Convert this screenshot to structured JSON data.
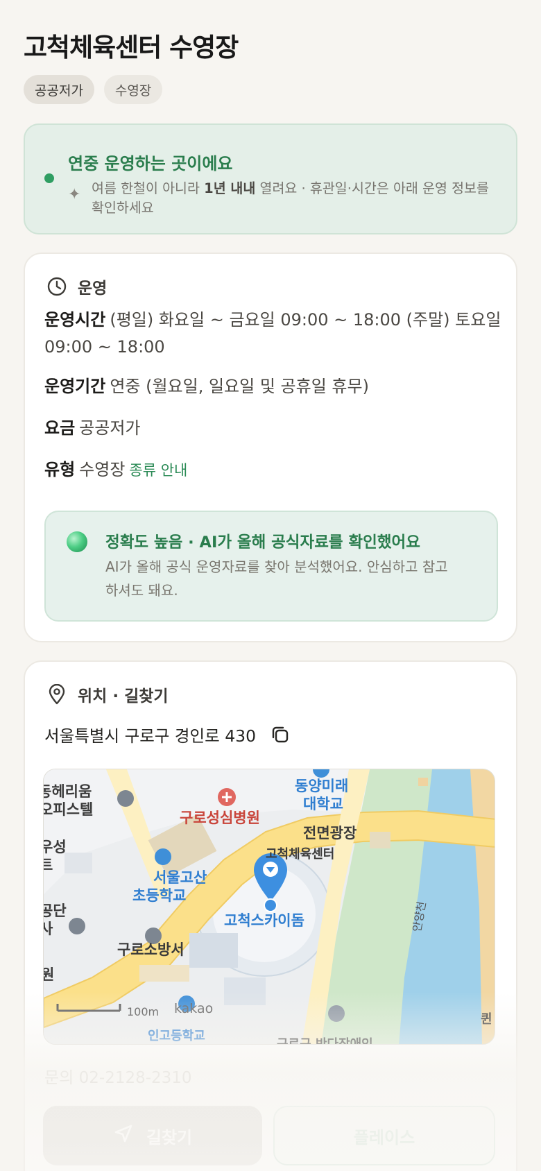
{
  "page": {
    "title": "고척체육센터 수영장",
    "chips": [
      "공공저가",
      "수영장"
    ]
  },
  "banner": {
    "title": "연중 운영하는 곳이에요",
    "text_before": "여름 한철이 아니라 ",
    "text_bold": "1년 내내",
    "text_after": " 열려요 · 휴관일·시간은 아래 운영 정보를 확인하세요",
    "icon": "sparkle-icon"
  },
  "operations": {
    "heading": "운영",
    "icon": "clock-icon",
    "hours_key": "운영시간",
    "hours_value": "(평일) 화요일 ~ 금요일 09:00 ~ 18:00 (주말) 토요일 09:00 ~ 18:00",
    "period_key": "운영기간",
    "period_value": "연중 (월요일, 일요일 및 공휴일 휴무)",
    "fee_key": "요금",
    "fee_value": "공공저가",
    "type_key": "유형",
    "type_value": "수영장",
    "type_link": "종류 안내",
    "accuracy": {
      "title": "정확도 높음 · AI가 올해 공식자료를 확인했어요",
      "text": "AI가 올해 공식 운영자료를 찾아 분석했어요. 안심하고 참고하셔도 돼요."
    }
  },
  "location": {
    "heading": "위치 · 길찾기",
    "icon": "location-pin-icon",
    "address": "서울특별시 구로구 경인로 430",
    "copy_icon": "copy-icon",
    "map_labels": {
      "l1": "동양미래",
      "l2": "대학교",
      "l3": "구로성심병원",
      "l4": "전면광장",
      "l5": "고척체육센터",
      "l6": "서울고산",
      "l7": "초등학교",
      "l8": "고척스카이돔",
      "l9": "구로소방서",
      "l10": "안양천",
      "l11": "동헤리움",
      "l12": "오피스텔",
      "l13": "우성",
      "l14": "트",
      "l15": "공단",
      "l16": "사",
      "l17": "원",
      "l18": "구로구 반다장애인",
      "l19": "인고등학교",
      "l20": "퀸",
      "scale": "100m",
      "brand": "kakao"
    },
    "phone": "문의 02-2128-2310",
    "route_button": "길찾기",
    "route_icon": "navigation-arrow-icon",
    "place_button": "플레이스"
  },
  "colors": {
    "accent_green": "#2a7d4d",
    "background": "#f7f5f1",
    "map_pin": "#3d8fe0"
  }
}
